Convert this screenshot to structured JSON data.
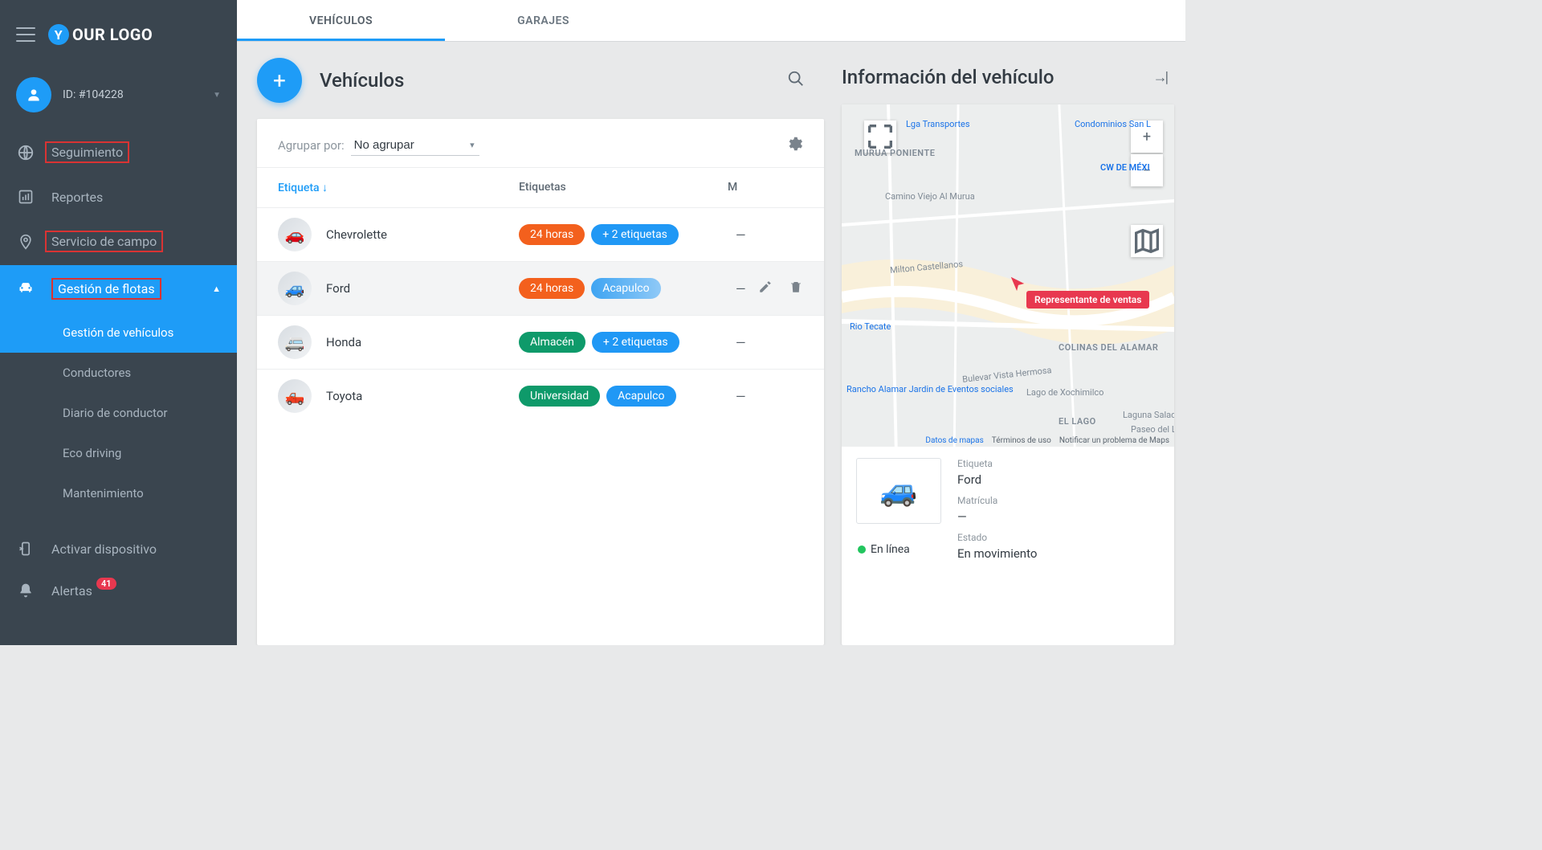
{
  "logo": {
    "letter": "Y",
    "rest": "OUR LOGO"
  },
  "user": {
    "id_label": "ID: #104228"
  },
  "nav": {
    "seguimiento": "Seguimiento",
    "reportes": "Reportes",
    "servicio": "Servicio de campo",
    "flotas": "Gestión de flotas",
    "sub_vehiculos": "Gestión de vehículos",
    "sub_conductores": "Conductores",
    "sub_diario": "Diario de conductor",
    "sub_eco": "Eco driving",
    "sub_mant": "Mantenimiento",
    "activar": "Activar dispositivo",
    "alertas": "Alertas",
    "alertas_badge": "41"
  },
  "tabs": {
    "vehiculos": "VEHÍCULOS",
    "garajes": "GARAJES"
  },
  "panel": {
    "title": "Vehículos",
    "group_label": "Agrupar por:",
    "group_value": "No agrupar",
    "col_label": "Etiqueta",
    "col_tags": "Etiquetas",
    "col_m": "M",
    "sort_arrow": "↓"
  },
  "rows": [
    {
      "name": "Chevrolette",
      "tags": [
        {
          "text": "24 horas",
          "cls": "orange"
        },
        {
          "text": "+ 2 etiquetas",
          "cls": "blue"
        }
      ],
      "m": "—"
    },
    {
      "name": "Ford",
      "tags": [
        {
          "text": "24 horas",
          "cls": "orange"
        },
        {
          "text": "Acapulco",
          "cls": "lightblue"
        }
      ],
      "m": "—",
      "hover": true
    },
    {
      "name": "Honda",
      "tags": [
        {
          "text": "Almacén",
          "cls": "green"
        },
        {
          "text": "+ 2 etiquetas",
          "cls": "blue"
        }
      ],
      "m": "—"
    },
    {
      "name": "Toyota",
      "tags": [
        {
          "text": "Universidad",
          "cls": "green"
        },
        {
          "text": "Acapulco",
          "cls": "blue"
        }
      ],
      "m": "—"
    }
  ],
  "right": {
    "title": "Información del vehículo",
    "marker_label": "Representante de ventas",
    "map_places": {
      "lga": "Lga Transportes",
      "condos": "Condominios San L",
      "murua": "MURUA PONIENTE",
      "cw": "CW DE MÉXI",
      "camino": "Camino Viejo Al Murua",
      "milton": "Milton Castellanos",
      "rio": "Rio Tecate",
      "colinas": "COLINAS DEL ALAMAR",
      "rancho": "Rancho Alamar Jardin de Eventos sociales",
      "bulevar": "Bulevar Vista Hermosa",
      "xoch": "Lago de Xochimilco",
      "ellago": "EL LAGO",
      "laguna": "Laguna Salada",
      "paseo": "Paseo del L"
    },
    "attrib": {
      "data": "Datos de mapas",
      "terms": "Términos de uso",
      "report": "Notificar un problema de Maps"
    },
    "info": {
      "etiqueta_label": "Etiqueta",
      "etiqueta_val": "Ford",
      "matricula_label": "Matrícula",
      "matricula_val": "—",
      "online": "En línea",
      "estado_label": "Estado",
      "estado_val": "En movimiento"
    }
  }
}
